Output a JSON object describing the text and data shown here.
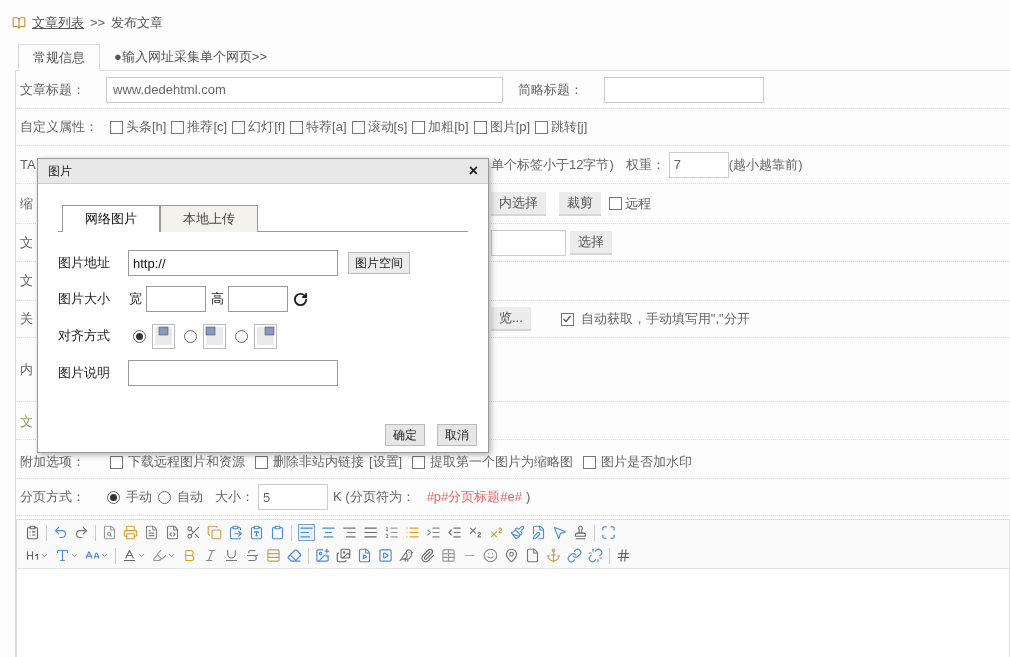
{
  "breadcrumb": {
    "link": "文章列表",
    "separator": ">>",
    "current": "发布文章"
  },
  "tabs": [
    {
      "label": "常规信息",
      "selected": true
    },
    {
      "label": "●输入网址采集单个网页>>",
      "selected": false
    }
  ],
  "title_row": {
    "label": "文章标题：",
    "value": "www.dedehtml.com",
    "short_label": "简略标题："
  },
  "flags": {
    "label": "自定义属性：",
    "items": [
      {
        "label": "头条[h]",
        "checked": false
      },
      {
        "label": "推荐[c]",
        "checked": false
      },
      {
        "label": "幻灯[f]",
        "checked": false
      },
      {
        "label": "特荐[a]",
        "checked": false
      },
      {
        "label": "滚动[s]",
        "checked": false
      },
      {
        "label": "加粗[b]",
        "checked": false
      },
      {
        "label": "图片[p]",
        "checked": false
      },
      {
        "label": "跳转[j]",
        "checked": false
      }
    ]
  },
  "tag_row": {
    "label": "TA",
    "hint": "单个标签小于12字节)",
    "weight_label": "权重：",
    "weight_value": "7",
    "weight_hint": "(越小越靠前)"
  },
  "thumb_row": {
    "label": "缩",
    "buttons": [
      "内选择",
      "裁剪"
    ],
    "remote": {
      "label": "远程",
      "checked": false
    }
  },
  "source_row": {
    "label": "文",
    "button": "选择"
  },
  "author_row": {
    "label": "文"
  },
  "keywords_row": {
    "label": "关",
    "button": "览...",
    "auto": {
      "label": "自动获取，手动填写用\",\"分开",
      "checked": true
    }
  },
  "content_row": {
    "label": "内"
  },
  "body_row": {
    "label": "文"
  },
  "options": {
    "label": "附加选项：",
    "items": [
      {
        "label": "下载远程图片和资源",
        "checked": false
      },
      {
        "label": "删除非站内链接",
        "link": "[设置]",
        "checked": false
      },
      {
        "label": "提取第一个图片为缩略图",
        "checked": false
      },
      {
        "label": "图片是否加水印",
        "checked": false
      }
    ]
  },
  "paging": {
    "label": "分页方式：",
    "modes": [
      {
        "label": "手动",
        "selected": true
      },
      {
        "label": "自动",
        "selected": false
      }
    ],
    "size_label": "大小：",
    "size_value": "5",
    "unit": "K (分页符为：",
    "marker": "#p#分页标题#e#",
    "close": ")"
  },
  "dialog": {
    "title": "图片",
    "close": "×",
    "tabs": [
      {
        "label": "网络图片",
        "selected": true
      },
      {
        "label": "本地上传",
        "selected": false
      }
    ],
    "url_label": "图片地址",
    "url_value": "http://",
    "space_button": "图片空间",
    "size_label": "图片大小",
    "width_label": "宽",
    "height_label": "高",
    "align_label": "对齐方式",
    "aligns": [
      {
        "kind": "none",
        "selected": true
      },
      {
        "kind": "left",
        "selected": false
      },
      {
        "kind": "right",
        "selected": false
      }
    ],
    "caption_label": "图片说明",
    "buttons": [
      "确定",
      "取消"
    ]
  }
}
